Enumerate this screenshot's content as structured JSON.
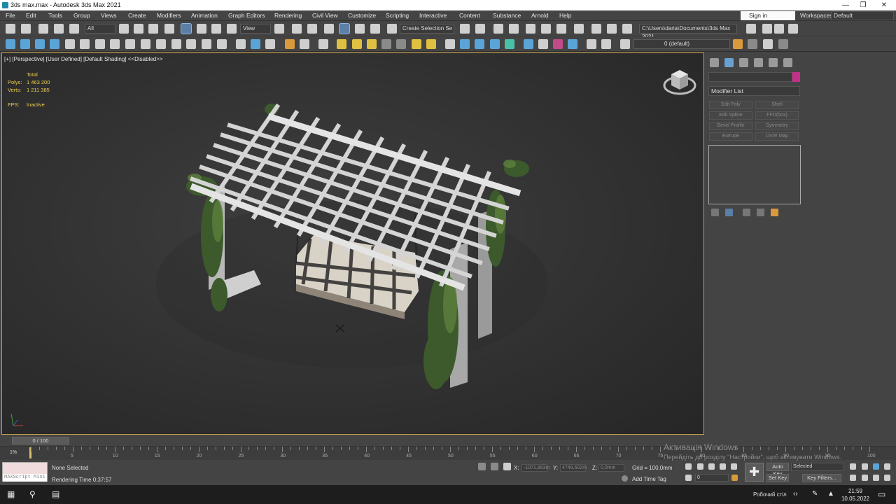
{
  "window": {
    "title": "3ds max.max - Autodesk 3ds Max 2021"
  },
  "menu": [
    "File",
    "Edit",
    "Tools",
    "Group",
    "Views",
    "Create",
    "Modifiers",
    "Animation",
    "Graph Editors",
    "Rendering",
    "Civil View",
    "Customize",
    "Scripting",
    "Interactive",
    "Content",
    "Substance",
    "Arnold",
    "Help"
  ],
  "account": {
    "signin": "Sign in",
    "workspaces_label": "Workspaces:",
    "workspace": "Default"
  },
  "toolbar": {
    "selection_filter": "All",
    "ref_coord": "View",
    "named_selection": "Create Selection Se",
    "project_path": "C:\\Users\\daria\\Documents\\3ds Max 2021",
    "layer": "0 (default)"
  },
  "viewport": {
    "label": "[+] [Perspective] [User Defined] [Default Shading] <<Disabled>>",
    "stats": {
      "total_label": "Total",
      "polys_label": "Polys:",
      "polys": "1 463 200",
      "verts_label": "Verts:",
      "verts": "1 211 385",
      "fps_label": "FPS:",
      "fps": "Inactive"
    }
  },
  "command_panel": {
    "modifier_list": "Modifier List",
    "modifier_buttons": [
      "Edit Poly",
      "Shell",
      "Edit Spline",
      "FFD(box)",
      "Bevel Profile",
      "Symmetry",
      "Extrude",
      "UVW Map"
    ]
  },
  "timeline": {
    "slider": "0 / 100",
    "ticks": [
      "5",
      "10",
      "15",
      "20",
      "25",
      "30",
      "35",
      "40",
      "45",
      "50",
      "55",
      "60",
      "65",
      "70",
      "75",
      "80",
      "85",
      "90",
      "95",
      "100"
    ]
  },
  "status": {
    "maxscript_placeholder": "MAXScript Mini",
    "selection": "None Selected",
    "render_time": "Rendering Time  0:37:57",
    "x_label": "X:",
    "x_value": "-1071,863m",
    "y_label": "Y:",
    "y_value": "4749,602m",
    "z_label": "Z:",
    "z_value": "0,0mm",
    "grid": "Grid = 100,0mm",
    "add_time_tag": "Add Time Tag",
    "auto_key": "Auto Key",
    "set_key": "Set Key",
    "key_mode": "Selected",
    "key_filters": "Key Filters...",
    "frame": "0",
    "percent": "1%"
  },
  "watermark": {
    "line1": "Активація Windows",
    "line2": "Перейдіть до розділу \"Настройки\", щоб активувати Windows."
  },
  "taskbar": {
    "desktop": "Робочий стіл",
    "time": "21:59",
    "date": "10.05.2022"
  }
}
